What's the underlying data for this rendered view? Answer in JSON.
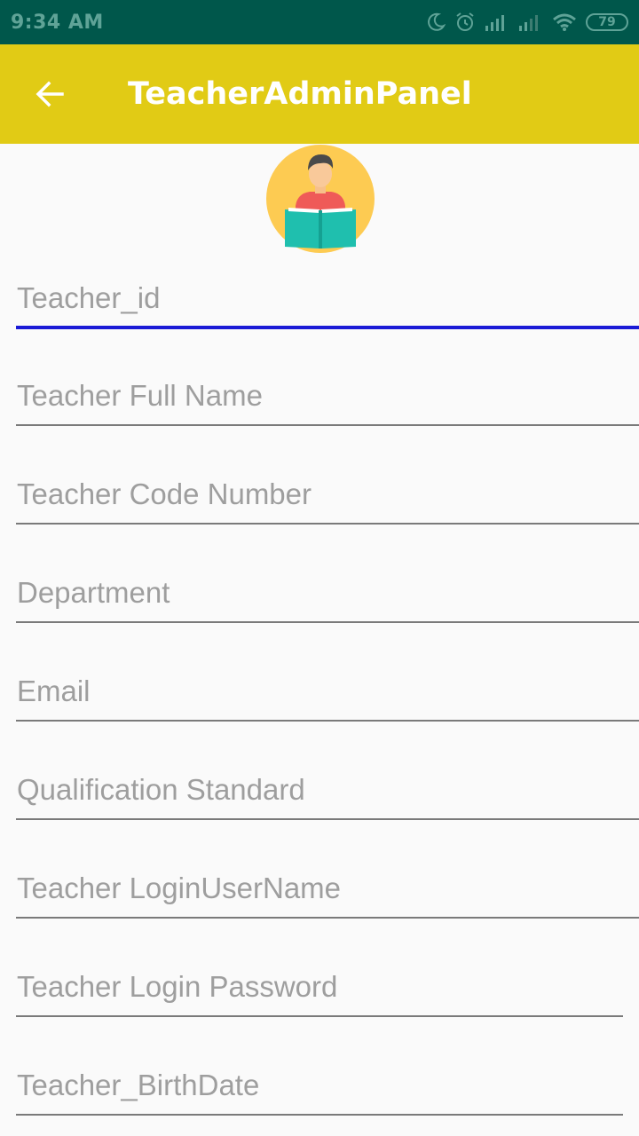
{
  "status_bar": {
    "time": "9:34 AM",
    "battery": "79",
    "icons": [
      "moon-icon",
      "alarm-icon",
      "signal-icon",
      "signal-icon",
      "wifi-icon",
      "battery-icon"
    ]
  },
  "app_bar": {
    "title": "TeacherAdminPanel",
    "back_icon": "arrow-back-icon"
  },
  "form": {
    "fields": [
      {
        "placeholder": "Teacher_id",
        "value": ""
      },
      {
        "placeholder": "Teacher Full Name",
        "value": ""
      },
      {
        "placeholder": "Teacher Code Number",
        "value": ""
      },
      {
        "placeholder": "Department",
        "value": ""
      },
      {
        "placeholder": "Email",
        "value": ""
      },
      {
        "placeholder": "Qualification Standard",
        "value": ""
      },
      {
        "placeholder": "Teacher LoginUserName",
        "value": ""
      },
      {
        "placeholder": "Teacher Login Password",
        "value": ""
      },
      {
        "placeholder": "Teacher_BirthDate",
        "value": ""
      }
    ]
  },
  "colors": {
    "status_bar": "#00574b",
    "app_bar": "#e1cb15",
    "focus_underline": "#1a1ad6",
    "background": "#fafafa"
  }
}
